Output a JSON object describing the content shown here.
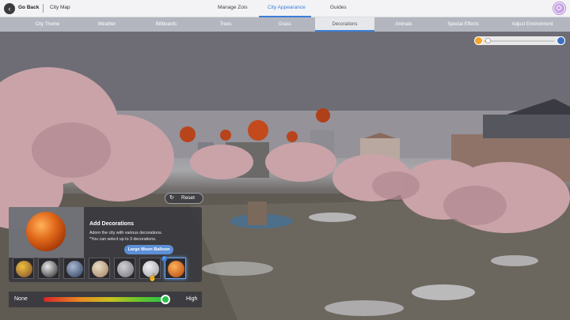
{
  "topbar": {
    "back_label": "Go Back",
    "breadcrumb": "City Map",
    "tabs": [
      {
        "label": "Manage Zois",
        "active": false
      },
      {
        "label": "City Appearance",
        "active": true
      },
      {
        "label": "Guides",
        "active": false
      }
    ]
  },
  "subtabs": [
    {
      "label": "City Theme",
      "active": false
    },
    {
      "label": "Weather",
      "active": false
    },
    {
      "label": "Billboards",
      "active": false
    },
    {
      "label": "Trees",
      "active": false
    },
    {
      "label": "Grass",
      "active": false
    },
    {
      "label": "Decorations",
      "active": true
    },
    {
      "label": "Animals",
      "active": false
    },
    {
      "label": "Special Effects",
      "active": false
    },
    {
      "label": "Adjust Environment",
      "active": false
    }
  ],
  "time_of_day": {
    "value": 0.05,
    "start_icon": "sun-icon",
    "end_icon": "moon-icon"
  },
  "reset_label": "Reset",
  "decoration_panel": {
    "title": "Add Decorations",
    "description_line1": "Adorn the city with various decorations.",
    "description_line2": "*You can select up to 3 decorations.",
    "tooltip": "Large Moon Balloon",
    "thumbnails": [
      {
        "icon": "character-balloon-icon",
        "colors": [
          "#f0c040",
          "#7a4a2a"
        ],
        "selected": false
      },
      {
        "icon": "panda-balloon-icon",
        "colors": [
          "#e8e8e8",
          "#222222"
        ],
        "selected": false
      },
      {
        "icon": "earth-balloon-icon",
        "colors": [
          "#a9b8d0",
          "#2a3a5a"
        ],
        "selected": false
      },
      {
        "icon": "jupiter-balloon-icon",
        "colors": [
          "#e8dcc4",
          "#a08060"
        ],
        "selected": false
      },
      {
        "icon": "moon-balloon-icon",
        "colors": [
          "#d0d0d4",
          "#70707a"
        ],
        "selected": false
      },
      {
        "icon": "large-moon-balloon-icon",
        "colors": [
          "#f0f0f2",
          "#9a9aa2"
        ],
        "selected": false
      },
      {
        "icon": "sun-balloon-icon",
        "colors": [
          "#ffb25a",
          "#b0400a"
        ],
        "selected": true
      }
    ]
  },
  "intensity": {
    "min_label": "None",
    "max_label": "High",
    "value": 1.0
  },
  "colors": {
    "accent": "#3c7fd9",
    "selected_border": "#6aa4f0"
  }
}
